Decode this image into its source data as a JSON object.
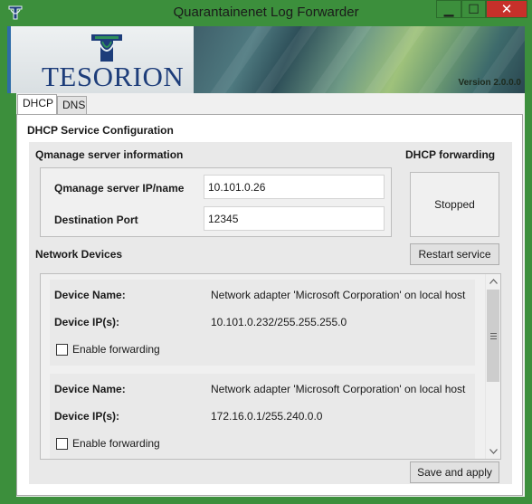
{
  "window": {
    "title": "Quarantainenet Log Forwarder",
    "icon": "tesorion-app-icon",
    "controls": {
      "minimize": "▁",
      "maximize": "☐",
      "close": "✕"
    },
    "frame_color": "#3c8f3c",
    "close_color": "#c7302a"
  },
  "banner": {
    "logo_text": "TESORION",
    "version": "Version 2.0.0.0",
    "brand_color": "#1d3d7a"
  },
  "tabs": [
    {
      "label": "DHCP",
      "selected": true
    },
    {
      "label": "DNS",
      "selected": false
    }
  ],
  "dhcp": {
    "section_title": "DHCP Service Configuration",
    "server_info_heading": "Qmanage server information",
    "server_label": "Qmanage server IP/name",
    "server_value": "10.101.0.26",
    "port_label": "Destination Port",
    "port_value": "12345",
    "forwarding_heading": "DHCP forwarding",
    "forwarding_status": "Stopped",
    "restart_button": "Restart service",
    "network_devices_heading": "Network Devices",
    "devices": [
      {
        "name_label": "Device Name:",
        "name_value": "Network adapter 'Microsoft Corporation' on local host",
        "ip_label": "Device IP(s):",
        "ip_value": "10.101.0.232/255.255.255.0",
        "forwarding_label": "Enable forwarding",
        "forwarding_checked": false
      },
      {
        "name_label": "Device Name:",
        "name_value": "Network adapter 'Microsoft Corporation' on local host",
        "ip_label": "Device IP(s):",
        "ip_value": "172.16.0.1/255.240.0.0",
        "forwarding_label": "Enable forwarding",
        "forwarding_checked": false
      }
    ],
    "save_button": "Save and apply"
  }
}
